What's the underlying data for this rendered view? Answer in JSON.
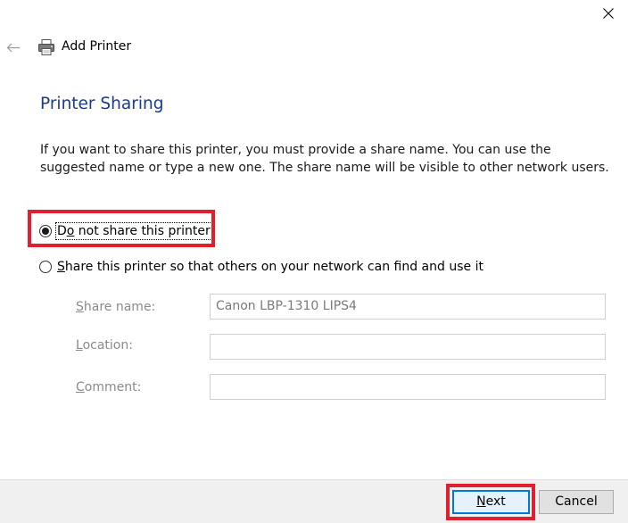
{
  "window": {
    "title": "Add Printer",
    "accent_color": "#1c3a8e",
    "highlight_color": "#e0202e",
    "icons": {
      "close": "close-icon",
      "back": "back-arrow-icon",
      "printer": "printer-icon"
    }
  },
  "page": {
    "title": "Printer Sharing",
    "intro": "If you want to share this printer, you must provide a share name. You can use the suggested name or type a new one. The share name will be visible to other network users."
  },
  "options": {
    "no_share": {
      "first": "D",
      "underlined": "o",
      "rest": " not share this printer",
      "selected": true
    },
    "share": {
      "underlined": "S",
      "rest": "hare this printer so that others on your network can find and use it",
      "selected": false
    }
  },
  "fields": {
    "share_name": {
      "label_u": "S",
      "label_rest": "hare name:",
      "value": "Canon LBP-1310 LIPS4"
    },
    "location": {
      "label_u": "L",
      "label_rest": "ocation:",
      "value": ""
    },
    "comment": {
      "label_u": "C",
      "label_rest": "omment:",
      "value": ""
    }
  },
  "footer": {
    "next": {
      "underlined": "N",
      "rest": "ext"
    },
    "cancel": "Cancel"
  }
}
